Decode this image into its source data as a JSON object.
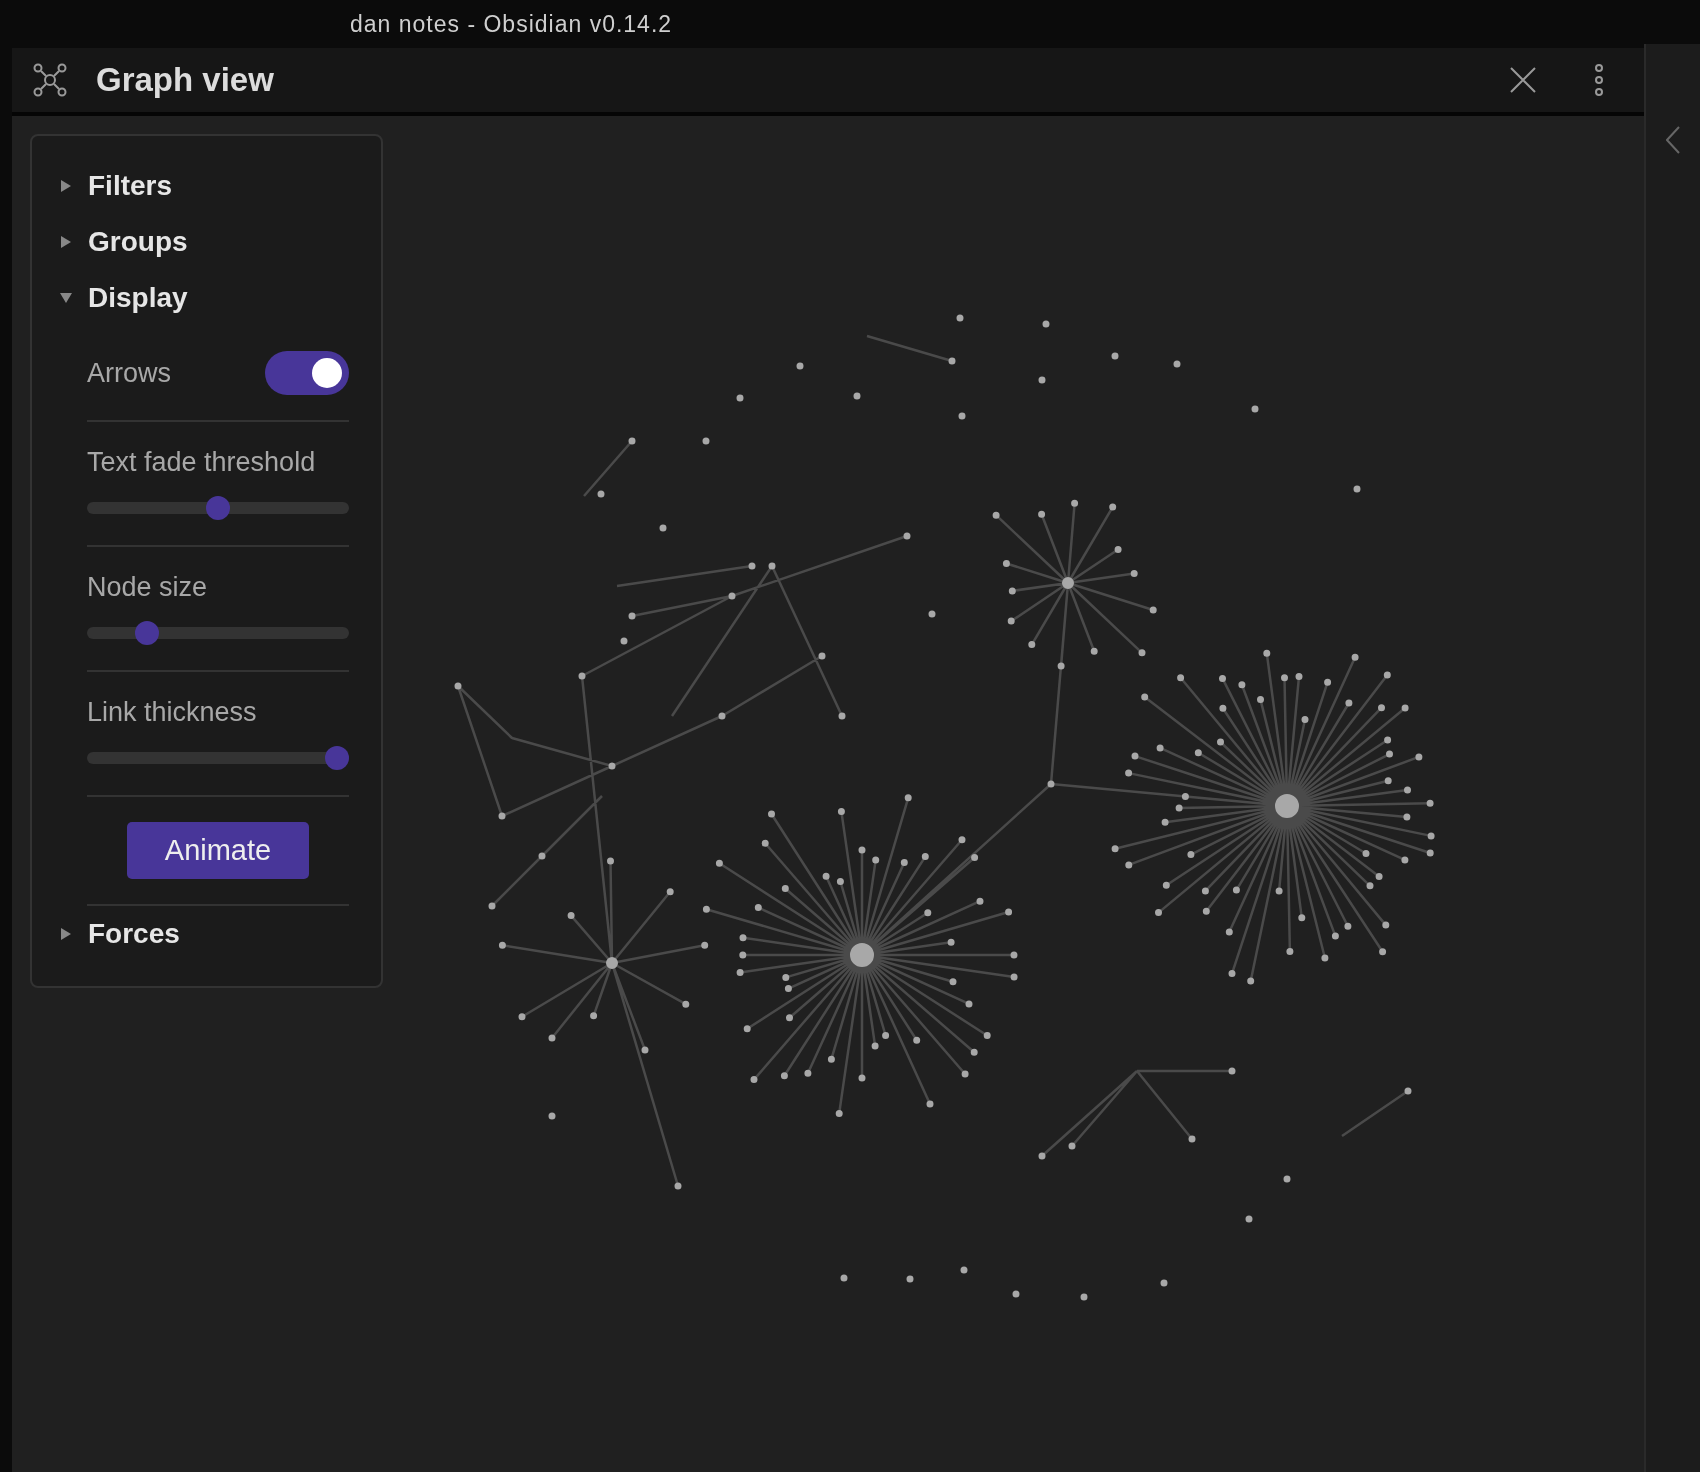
{
  "window": {
    "title": "dan notes - Obsidian v0.14.2"
  },
  "view": {
    "title": "Graph view"
  },
  "sections": [
    {
      "title": "Filters",
      "expanded": false
    },
    {
      "title": "Groups",
      "expanded": false
    },
    {
      "title": "Display",
      "expanded": true,
      "controls": [
        {
          "kind": "toggle",
          "label": "Arrows",
          "on": true
        },
        {
          "kind": "slider",
          "label": "Text fade threshold",
          "level": 0.5
        },
        {
          "kind": "slider",
          "label": "Node size",
          "level": 0.2
        },
        {
          "kind": "slider",
          "label": "Link thickness",
          "level": 1
        },
        {
          "kind": "button",
          "label": "Animate"
        }
      ]
    },
    {
      "title": "Forces",
      "expanded": false
    }
  ]
}
